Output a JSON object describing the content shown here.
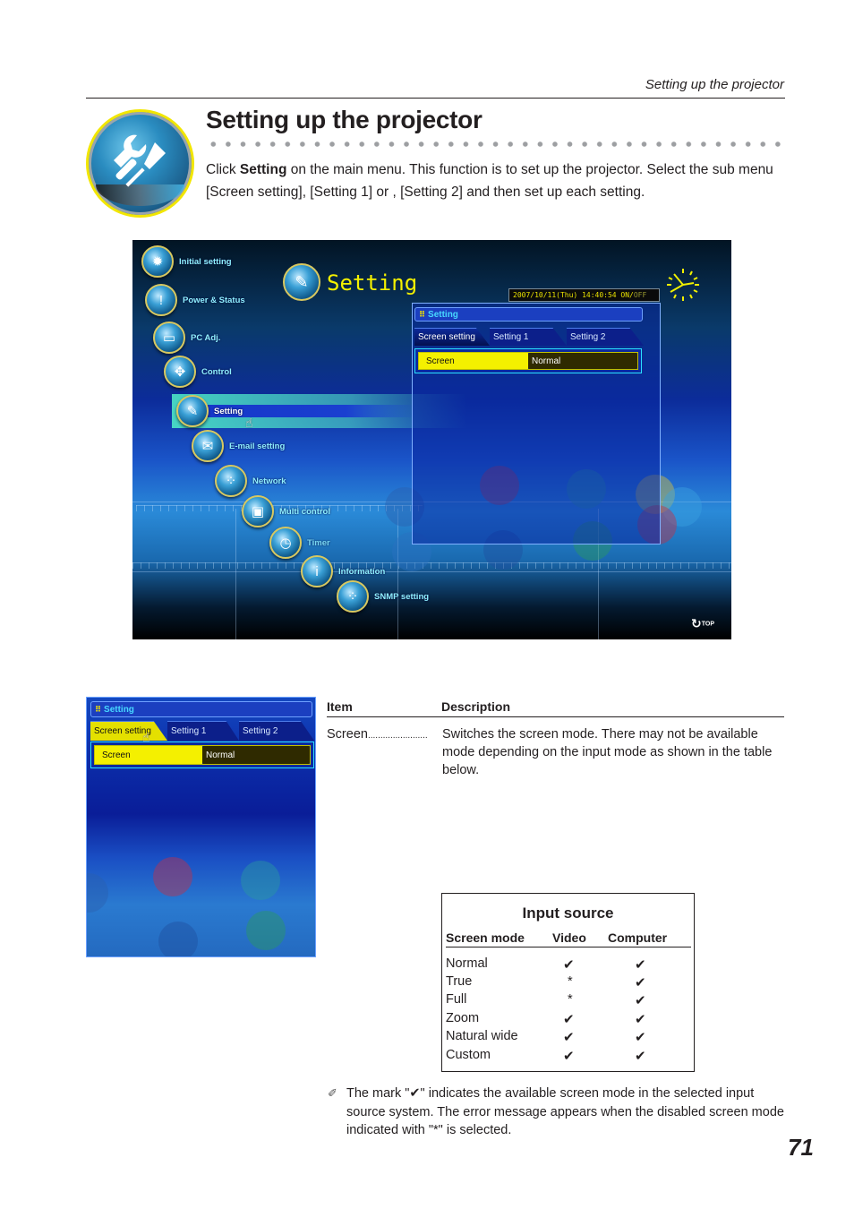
{
  "running_head": "Setting up the projector",
  "title": "Setting up the projector",
  "intro": {
    "before": "Click ",
    "bold": "Setting",
    "after": " on the main menu. This function is to set up the projector. Select the sub menu [Screen setting], [Setting 1] or , [Setting 2] and then set up each setting."
  },
  "screen": {
    "title": "Setting",
    "clock_text": "2007/10/11(Thu)  14:40:54  ON/",
    "clock_off": "OFF",
    "top_label": "TOP",
    "menu": [
      {
        "label": "Initial setting",
        "icon": "gear-projector-icon",
        "glyph": "✹"
      },
      {
        "label": "Power & Status",
        "icon": "power-status-icon",
        "glyph": "!"
      },
      {
        "label": "PC Adj.",
        "icon": "monitor-icon",
        "glyph": "▭"
      },
      {
        "label": "Control",
        "icon": "direction-pad-icon",
        "glyph": "✥"
      },
      {
        "label": "Setting",
        "icon": "wrench-screwdriver-icon",
        "glyph": "✎",
        "active": true
      },
      {
        "label": "E-mail setting",
        "icon": "envelope-icon",
        "glyph": "✉"
      },
      {
        "label": "Network",
        "icon": "network-icon",
        "glyph": "⁘"
      },
      {
        "label": "Multi control",
        "icon": "multi-control-icon",
        "glyph": "▣"
      },
      {
        "label": "Timer",
        "icon": "clock-icon",
        "glyph": "◷"
      },
      {
        "label": "Information",
        "icon": "info-icon",
        "glyph": "i"
      },
      {
        "label": "SNMP setting",
        "icon": "snmp-icon",
        "glyph": "⁘"
      }
    ],
    "panel": {
      "header": "Setting",
      "tabs": [
        "Screen setting",
        "Setting 1",
        "Setting 2"
      ],
      "field_label": "Screen",
      "field_value": "Normal"
    }
  },
  "description": {
    "col_item": "Item",
    "col_desc": "Description",
    "item": "Screen",
    "leader": "........................",
    "text": "Switches the screen mode. There may not be available mode depending on the input mode as shown in the table below."
  },
  "input_source": {
    "title": "Input source",
    "columns": [
      "Screen mode",
      "Video",
      "Computer"
    ],
    "rows": [
      {
        "mode": "Normal",
        "video": "✔",
        "computer": "✔"
      },
      {
        "mode": "True",
        "video": "*",
        "computer": "✔"
      },
      {
        "mode": "Full",
        "video": "*",
        "computer": "✔"
      },
      {
        "mode": "Zoom",
        "video": "✔",
        "computer": "✔"
      },
      {
        "mode": "Natural wide",
        "video": "✔",
        "computer": "✔"
      },
      {
        "mode": "Custom",
        "video": "✔",
        "computer": "✔"
      }
    ]
  },
  "note": {
    "icon": "✐",
    "text": "The mark \"✔\" indicates the available screen mode in the selected input source system. The error message appears when the disabled screen mode indicated with \"*\" is selected."
  },
  "page_number": "71"
}
